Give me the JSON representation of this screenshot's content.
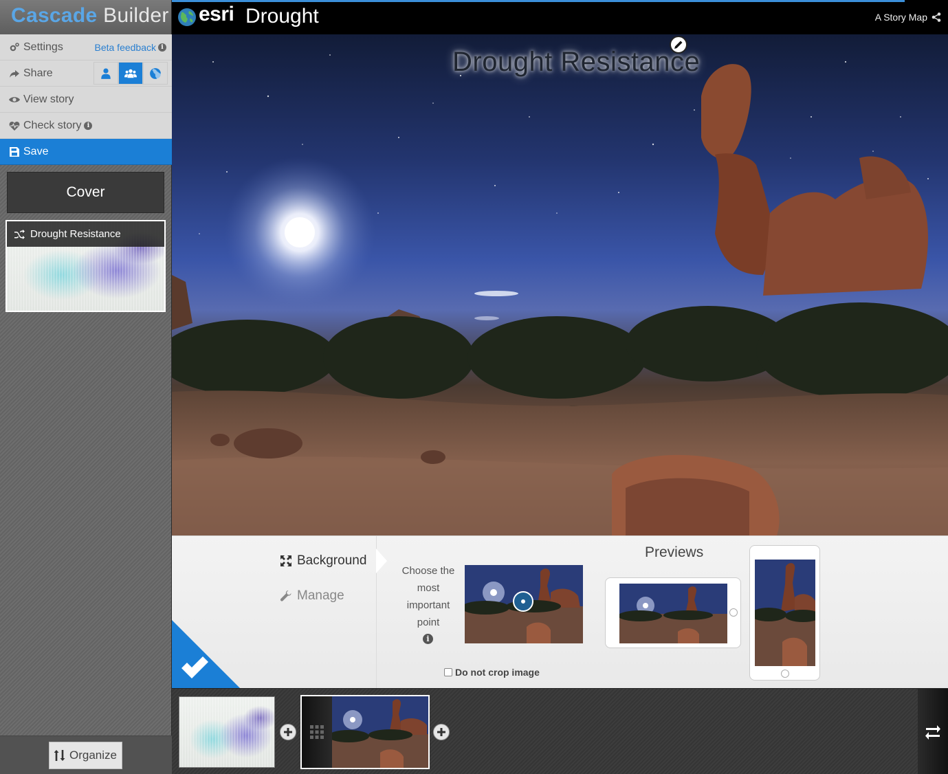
{
  "sidebar": {
    "brand_part1": "Cascade",
    "brand_part2": "Builder",
    "settings_label": "Settings",
    "beta_feedback_label": "Beta feedback",
    "share_label": "Share",
    "view_story_label": "View story",
    "check_story_label": "Check story",
    "save_label": "Save",
    "cover_label": "Cover",
    "section_label": "Drought Resistance",
    "organize_label": "Organize"
  },
  "header": {
    "logo_text": "esri",
    "story_title": "Drought",
    "story_map_label": "A Story Map",
    "progress_fraction": 0.944
  },
  "hero": {
    "title": "Drought Resistance"
  },
  "panel": {
    "tab_background": "Background",
    "tab_manage": "Manage",
    "choose_text": "Choose the most important point",
    "nocrop_label": "Do not crop image",
    "previews_title": "Previews"
  },
  "icons": {
    "settings": "cogs-icon",
    "share": "share-arrow-icon",
    "view": "eye-icon",
    "check": "heartbeat-icon",
    "save": "floppy-icon",
    "sharing_private": "user-icon",
    "sharing_org": "group-icon",
    "sharing_public": "globe-icon",
    "section": "shuffle-icon",
    "organize": "sort-arrows-icon",
    "background_tab": "expand-icon",
    "manage_tab": "wrench-icon",
    "edit_title": "pencil-icon",
    "confirm": "checkmark-icon",
    "add": "plus-circle-icon",
    "drag": "grid-icon",
    "toggle": "swap-arrows-icon"
  },
  "colors": {
    "accent": "#1b7fd6",
    "brand_blue": "#5aa6e6",
    "header_bg": "#000000"
  }
}
